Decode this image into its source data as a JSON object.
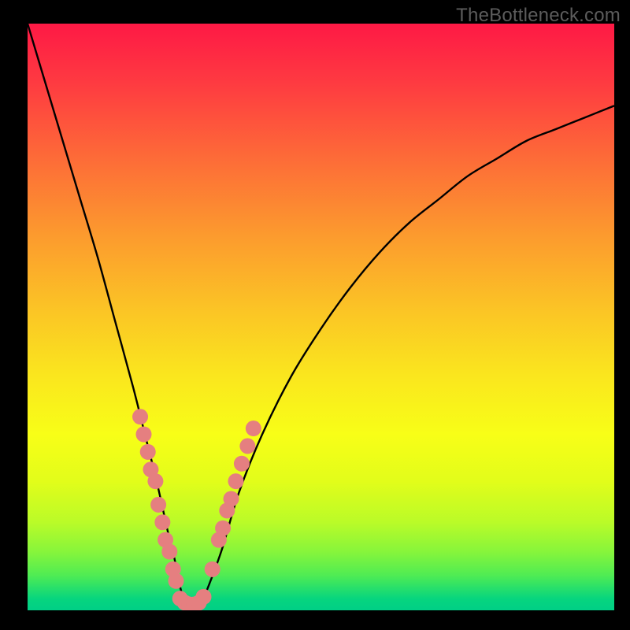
{
  "watermark": "TheBottleneck.com",
  "colors": {
    "background": "#000000",
    "curve": "#000000",
    "dot_fill": "#e57f80",
    "gradient_top": "#fe1945",
    "gradient_bottom": "#00cf86"
  },
  "chart_data": {
    "type": "line",
    "title": "",
    "xlabel": "",
    "ylabel": "",
    "xlim": [
      0,
      100
    ],
    "ylim": [
      0,
      100
    ],
    "curve": {
      "name": "bottleneck-curve",
      "x": [
        0,
        3,
        6,
        9,
        12,
        15,
        18,
        20,
        22,
        24,
        25,
        26,
        27,
        28,
        29,
        30,
        33,
        36,
        40,
        45,
        50,
        55,
        60,
        65,
        70,
        75,
        80,
        85,
        90,
        95,
        100
      ],
      "y": [
        100,
        90,
        80,
        70,
        60,
        49,
        38,
        30,
        22,
        13,
        9,
        4,
        1,
        0,
        0,
        2,
        10,
        20,
        30,
        40,
        48,
        55,
        61,
        66,
        70,
        74,
        77,
        80,
        82,
        84,
        86
      ]
    },
    "dot_clusters": [
      {
        "name": "left-cluster",
        "points": [
          {
            "x": 19.2,
            "y": 33
          },
          {
            "x": 19.8,
            "y": 30
          },
          {
            "x": 20.5,
            "y": 27
          },
          {
            "x": 21.0,
            "y": 24
          },
          {
            "x": 21.8,
            "y": 22
          },
          {
            "x": 22.3,
            "y": 18
          },
          {
            "x": 23.0,
            "y": 15
          },
          {
            "x": 23.5,
            "y": 12
          },
          {
            "x": 24.2,
            "y": 10
          },
          {
            "x": 24.8,
            "y": 7
          },
          {
            "x": 25.3,
            "y": 5
          }
        ]
      },
      {
        "name": "valley-cluster",
        "points": [
          {
            "x": 26.0,
            "y": 2.0
          },
          {
            "x": 26.8,
            "y": 1.3
          },
          {
            "x": 27.6,
            "y": 1.0
          },
          {
            "x": 28.4,
            "y": 1.0
          },
          {
            "x": 29.2,
            "y": 1.3
          },
          {
            "x": 30.0,
            "y": 2.3
          }
        ]
      },
      {
        "name": "right-cluster",
        "points": [
          {
            "x": 31.5,
            "y": 7
          },
          {
            "x": 32.6,
            "y": 12
          },
          {
            "x": 33.3,
            "y": 14
          },
          {
            "x": 34.0,
            "y": 17
          },
          {
            "x": 34.7,
            "y": 19
          },
          {
            "x": 35.5,
            "y": 22
          },
          {
            "x": 36.5,
            "y": 25
          },
          {
            "x": 37.5,
            "y": 28
          },
          {
            "x": 38.5,
            "y": 31
          }
        ]
      }
    ]
  }
}
